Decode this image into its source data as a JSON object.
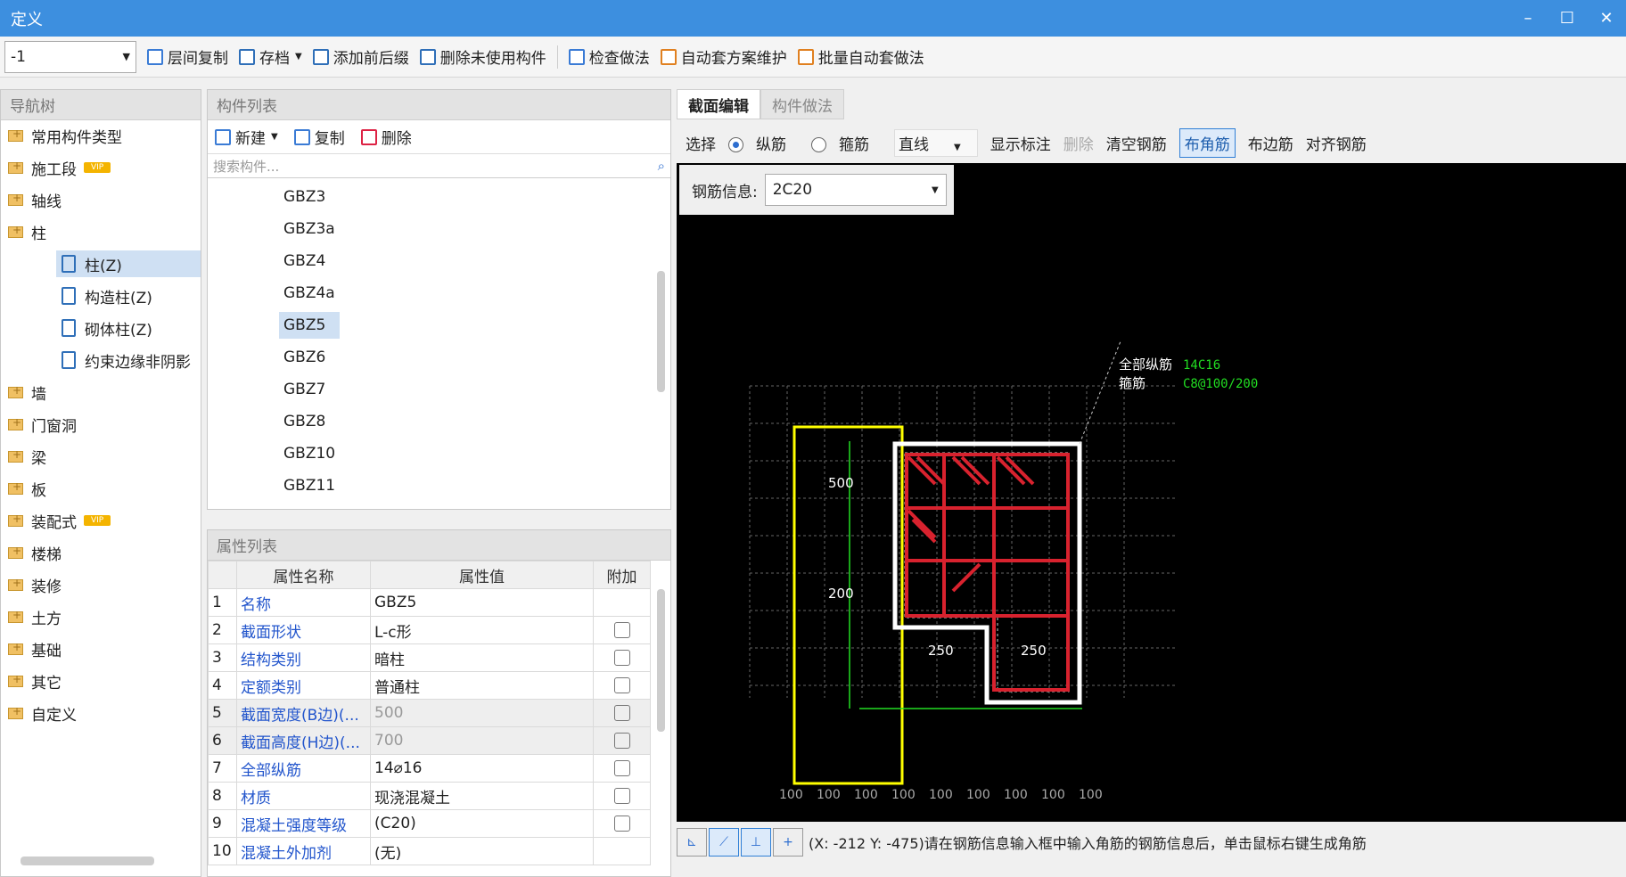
{
  "window": {
    "title": "定义"
  },
  "toolbar": {
    "floor": "-1",
    "items": [
      "层间复制",
      "存档",
      "添加前后缀",
      "删除未使用构件",
      "检查做法",
      "自动套方案维护",
      "批量自动套做法"
    ]
  },
  "nav": {
    "header": "导航树",
    "vip": "VIP",
    "items": [
      "常用构件类型",
      "施工段",
      "轴线",
      "柱",
      "墙",
      "门窗洞",
      "梁",
      "板",
      "装配式",
      "楼梯",
      "装修",
      "土方",
      "基础",
      "其它",
      "自定义"
    ],
    "sub": [
      "柱(Z)",
      "构造柱(Z)",
      "砌体柱(Z)",
      "约束边缘非阴影"
    ]
  },
  "members": {
    "header": "构件列表",
    "new": "新建",
    "copy": "复制",
    "delete": "删除",
    "search_placeholder": "搜索构件...",
    "items": [
      "GBZ3",
      "GBZ3a",
      "GBZ4",
      "GBZ4a",
      "GBZ5",
      "GBZ6",
      "GBZ7",
      "GBZ8",
      "GBZ10",
      "GBZ11"
    ],
    "selected": "GBZ5"
  },
  "props": {
    "header": "属性列表",
    "cols": [
      "属性名称",
      "属性值",
      "附加"
    ],
    "rows": [
      {
        "n": "1",
        "name": "名称",
        "value": "GBZ5"
      },
      {
        "n": "2",
        "name": "截面形状",
        "value": "L-c形"
      },
      {
        "n": "3",
        "name": "结构类别",
        "value": "暗柱"
      },
      {
        "n": "4",
        "name": "定额类别",
        "value": "普通柱"
      },
      {
        "n": "5",
        "name": "截面宽度(B边)(...",
        "value": "500"
      },
      {
        "n": "6",
        "name": "截面高度(H边)(...",
        "value": "700"
      },
      {
        "n": "7",
        "name": "全部纵筋",
        "value": "14⌀16"
      },
      {
        "n": "8",
        "name": "材质",
        "value": "现浇混凝土"
      },
      {
        "n": "9",
        "name": "混凝土强度等级",
        "value": "(C20)"
      },
      {
        "n": "10",
        "name": "混凝土外加剂",
        "value": "(无)"
      }
    ]
  },
  "editor": {
    "tabs": [
      "截面编辑",
      "构件做法"
    ],
    "toolbar": {
      "select": "选择",
      "longitudinal": "纵筋",
      "stirrup": "箍筋",
      "line": "直线",
      "show_label": "显示标注",
      "delete": "删除",
      "clear": "清空钢筋",
      "corner": "布角筋",
      "edge": "布边筋",
      "align": "对齐钢筋"
    },
    "rebar_info_label": "钢筋信息:",
    "rebar_info_value": "2C20",
    "anno": {
      "all_long_label": "全部纵筋",
      "all_long_value": "14C16",
      "stirrup_label": "箍筋",
      "stirrup_value": "C8@100/200"
    },
    "dims": {
      "h1": "500",
      "h2": "200",
      "w1": "250",
      "w2": "250"
    },
    "grid_label": "100",
    "status": "(X: -212 Y: -475)请在钢筋信息输入框中输入角筋的钢筋信息后，单击鼠标右键生成角筋"
  },
  "colors": {
    "titlebar": "#3d8fdf",
    "link": "#2255cc",
    "rebar": "#d8222e",
    "dim": "#22dd22",
    "highlight": "#ffff00"
  }
}
